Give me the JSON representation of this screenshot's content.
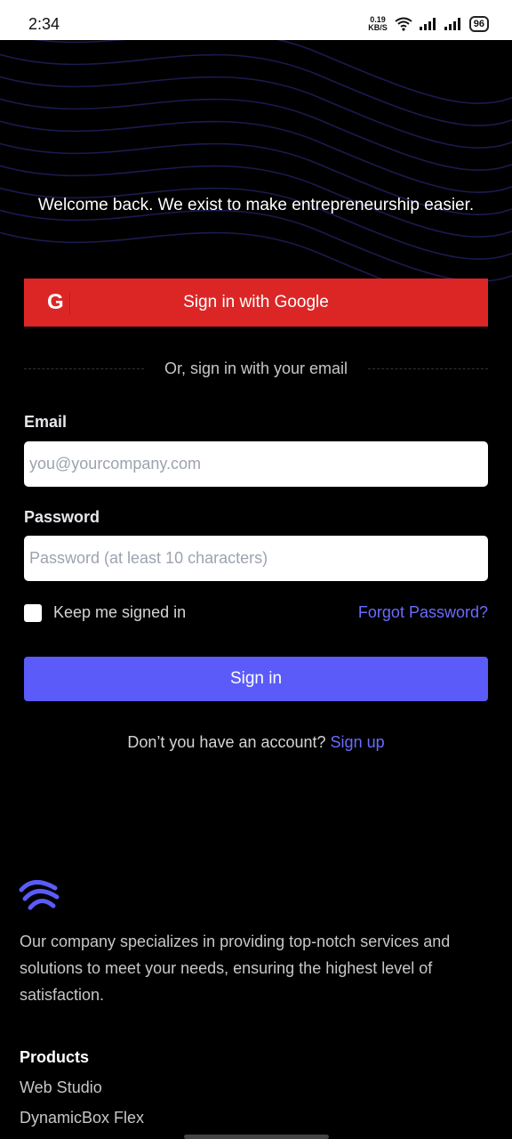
{
  "status_bar": {
    "time": "2:34",
    "net_speed_value": "0.19",
    "net_speed_unit": "KB/S",
    "battery": "96"
  },
  "hero": {
    "welcome_text": "Welcome back. We exist to make entrepreneurship easier."
  },
  "google_button": {
    "icon_letter": "G",
    "label": "Sign in with Google"
  },
  "divider_text": "Or, sign in with your email",
  "form": {
    "email_label": "Email",
    "email_placeholder": "you@yourcompany.com",
    "password_label": "Password",
    "password_placeholder": "Password (at least 10 characters)",
    "keep_signed_in": "Keep me signed in",
    "forgot_password": "Forgot Password?",
    "submit_label": "Sign in"
  },
  "signup": {
    "prompt": "Don’t you have an account?",
    "link": "Sign up"
  },
  "footer": {
    "description": "Our company specializes in providing top-notch services and solutions to meet your needs, ensuring the highest level of satisfaction.",
    "products_title": "Products",
    "products": [
      "Web Studio",
      "DynamicBox Flex"
    ]
  },
  "colors": {
    "google_red": "#dc2626",
    "accent": "#5b5bfa",
    "link": "#6b6bff",
    "background": "#000000"
  }
}
